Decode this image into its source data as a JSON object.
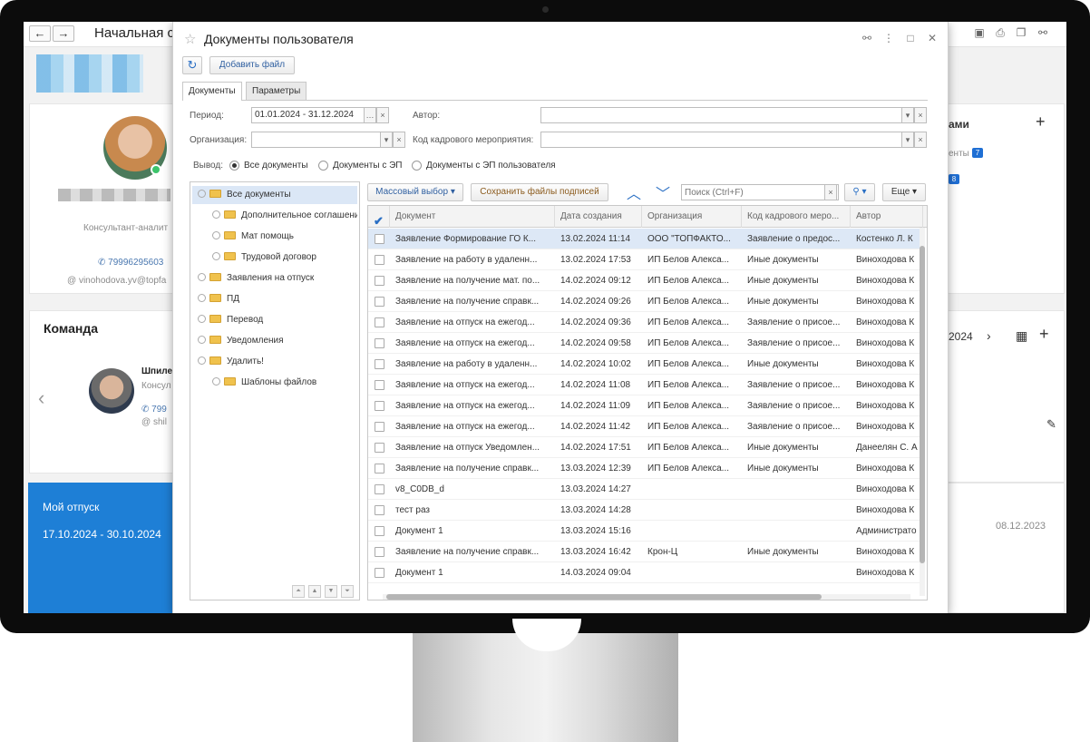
{
  "app": {
    "title": "Начальная с",
    "nav_back": "←",
    "nav_forward": "→"
  },
  "profile": {
    "position": "Консультант-аналит",
    "phone": "79996295603",
    "email": "vinohodova.yv@topfa"
  },
  "team": {
    "title": "Команда",
    "member_name": "Шпиле",
    "member_position": "Консул",
    "member_phone": "799",
    "member_email": "shil"
  },
  "vacation": {
    "title": "Мой отпуск",
    "dates": "17.10.2024 - 30.10.2024"
  },
  "right_panel": {
    "header_fragment": "ами",
    "row_fragment": "енты",
    "badge_1": "7",
    "badge_2": "8",
    "date_nav": "2024",
    "date_value": "08.12.2023"
  },
  "modal": {
    "title": "Документы пользователя",
    "add_file_label": "Добавить файл",
    "tabs": [
      {
        "label": "Документы",
        "active": true
      },
      {
        "label": "Параметры",
        "active": false
      }
    ],
    "filters": {
      "period_label": "Период:",
      "period_value": "01.01.2024 - 31.12.2024",
      "author_label": "Автор:",
      "author_value": "",
      "org_label": "Организация:",
      "org_value": "",
      "hr_code_label": "Код кадрового мероприятия:",
      "hr_code_value": "",
      "output_label": "Вывод:",
      "output_options": [
        {
          "label": "Все документы",
          "selected": true
        },
        {
          "label": "Документы с ЭП",
          "selected": false
        },
        {
          "label": "Документы с ЭП пользователя",
          "selected": false
        }
      ]
    },
    "toolbar": {
      "mass_select_label": "Массовый выбор",
      "save_signatures_label": "Сохранить файлы подписей",
      "search_placeholder": "Поиск (Ctrl+F)",
      "more_label": "Еще"
    },
    "tree": [
      {
        "label": "Все документы",
        "level": 0,
        "selected": true,
        "expander": true
      },
      {
        "label": "Дополнительное соглашение",
        "level": 1,
        "selected": false,
        "expander": true
      },
      {
        "label": "Мат помощь",
        "level": 1,
        "selected": false,
        "expander": true
      },
      {
        "label": "Трудовой договор",
        "level": 1,
        "selected": false,
        "expander": true
      },
      {
        "label": "Заявления на отпуск",
        "level": 0,
        "selected": false,
        "expander": true
      },
      {
        "label": "ПД",
        "level": 0,
        "selected": false,
        "expander": true
      },
      {
        "label": "Перевод",
        "level": 0,
        "selected": false,
        "expander": true
      },
      {
        "label": "Уведомления",
        "level": 0,
        "selected": false,
        "expander": true
      },
      {
        "label": "Удалить!",
        "level": 0,
        "selected": false,
        "expander": true
      },
      {
        "label": "Шаблоны файлов",
        "level": 1,
        "selected": false,
        "expander": true
      }
    ],
    "grid": {
      "columns": [
        "Документ",
        "Дата создания",
        "Организация",
        "Код кадрового меро...",
        "Автор"
      ],
      "rows": [
        [
          "Заявление Формирование ГО К...",
          "13.02.2024 11:14",
          "ООО \"ТОПФАКТО...",
          "Заявление о предос...",
          "Костенко Л. К"
        ],
        [
          "Заявление на работу в удаленн...",
          "13.02.2024 17:53",
          "ИП Белов Алекса...",
          "Иные документы",
          "Виноходова К"
        ],
        [
          "Заявление на получение мат. по...",
          "14.02.2024 09:12",
          "ИП Белов Алекса...",
          "Иные документы",
          "Виноходова К"
        ],
        [
          "Заявление на получение справк...",
          "14.02.2024 09:26",
          "ИП Белов Алекса...",
          "Иные документы",
          "Виноходова К"
        ],
        [
          "Заявление на отпуск на ежегод...",
          "14.02.2024 09:36",
          "ИП Белов Алекса...",
          "Заявление о присое...",
          "Виноходова К"
        ],
        [
          "Заявление на отпуск на ежегод...",
          "14.02.2024 09:58",
          "ИП Белов Алекса...",
          "Заявление о присое...",
          "Виноходова К"
        ],
        [
          "Заявление на работу в удаленн...",
          "14.02.2024 10:02",
          "ИП Белов Алекса...",
          "Иные документы",
          "Виноходова К"
        ],
        [
          "Заявление на отпуск на ежегод...",
          "14.02.2024 11:08",
          "ИП Белов Алекса...",
          "Заявление о присое...",
          "Виноходова К"
        ],
        [
          "Заявление на отпуск на ежегод...",
          "14.02.2024 11:09",
          "ИП Белов Алекса...",
          "Заявление о присое...",
          "Виноходова К"
        ],
        [
          "Заявление на отпуск на ежегод...",
          "14.02.2024 11:42",
          "ИП Белов Алекса...",
          "Заявление о присое...",
          "Виноходова К"
        ],
        [
          "Заявление на отпуск Уведомлен...",
          "14.02.2024 17:51",
          "ИП Белов Алекса...",
          "Иные документы",
          "Данеелян С. А"
        ],
        [
          "Заявление на получение справк...",
          "13.03.2024 12:39",
          "ИП Белов Алекса...",
          "Иные документы",
          "Виноходова К"
        ],
        [
          "v8_C0DB_d",
          "13.03.2024 14:27",
          "",
          "",
          "Виноходова К"
        ],
        [
          "тест раз",
          "13.03.2024 14:28",
          "",
          "",
          "Виноходова К"
        ],
        [
          "Документ 1",
          "13.03.2024 15:16",
          "",
          "",
          "Администрато"
        ],
        [
          "Заявление на получение справк...",
          "13.03.2024 16:42",
          "Крон-Ц",
          "Иные документы",
          "Виноходова К"
        ],
        [
          "Документ 1",
          "14.03.2024 09:04",
          "",
          "",
          "Виноходова К"
        ]
      ]
    }
  }
}
